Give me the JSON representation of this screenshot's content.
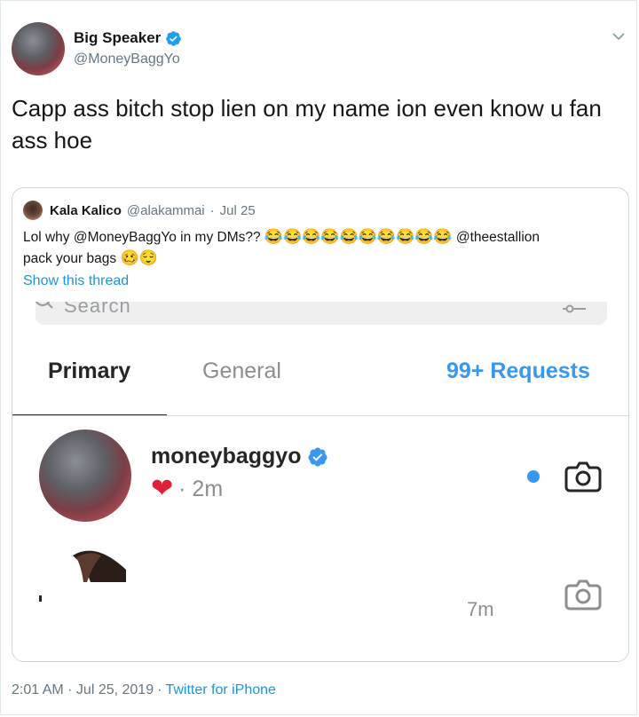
{
  "tweet": {
    "display_name": "Big Speaker",
    "handle": "@MoneyBaggYo",
    "text": "Capp ass bitch stop lien on my name ion even know u fan ass hoe",
    "footer_time": "2:01 AM · Jul 25, 2019",
    "footer_sep": "·",
    "footer_source": "Twitter for iPhone"
  },
  "quote": {
    "display_name": "Kala Kalico",
    "handle": "@alakammai",
    "dot": "·",
    "date": "Jul 25",
    "text_a": "Lol why @MoneyBaggYo in my DMs?? ",
    "emoji_laugh": "😂😂😂😂😂😂😂😂😂😂",
    "text_b": " @theestallion",
    "text_c": "pack your bags ",
    "emoji_end": "🥴😌",
    "show_thread": "Show this thread"
  },
  "screenshot": {
    "search_ghost": "Search",
    "tabs": [
      "Primary",
      "General",
      "99+ Requests"
    ],
    "dm1": {
      "name": "moneybaggyo",
      "heart": "❤",
      "time": "· 2m"
    },
    "dm2": {
      "time": "7m"
    }
  },
  "colors": {
    "link": "#1b95e0",
    "ig_blue": "#3897f0",
    "muted": "#657786"
  },
  "icons": [
    "verified-badge-icon",
    "chevron-down-icon",
    "camera-icon",
    "search-icon",
    "filter-icon"
  ]
}
